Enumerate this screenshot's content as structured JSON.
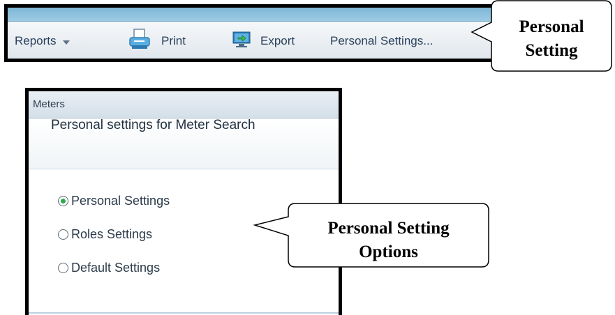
{
  "toolbar": {
    "reports_label": "Reports",
    "print_label": "Print",
    "export_label": "Export",
    "personal_settings_label": "Personal Settings..."
  },
  "callouts": {
    "top": {
      "line1": "Personal",
      "line2": "Setting"
    },
    "options": {
      "line1": "Personal Setting",
      "line2": "Options"
    }
  },
  "panel": {
    "header_title": "Meters",
    "section_title": "Personal settings for Meter Search",
    "options": [
      {
        "label": "Personal Settings",
        "selected": true
      },
      {
        "label": "Roles Settings",
        "selected": false
      },
      {
        "label": "Default Settings",
        "selected": false
      }
    ]
  },
  "colors": {
    "toolbar_text": "#2a3f5a",
    "radio_selected": "#2fa84f",
    "frame_border": "#000000"
  },
  "icons": [
    "caret-down-icon",
    "printer-icon",
    "export-icon"
  ]
}
